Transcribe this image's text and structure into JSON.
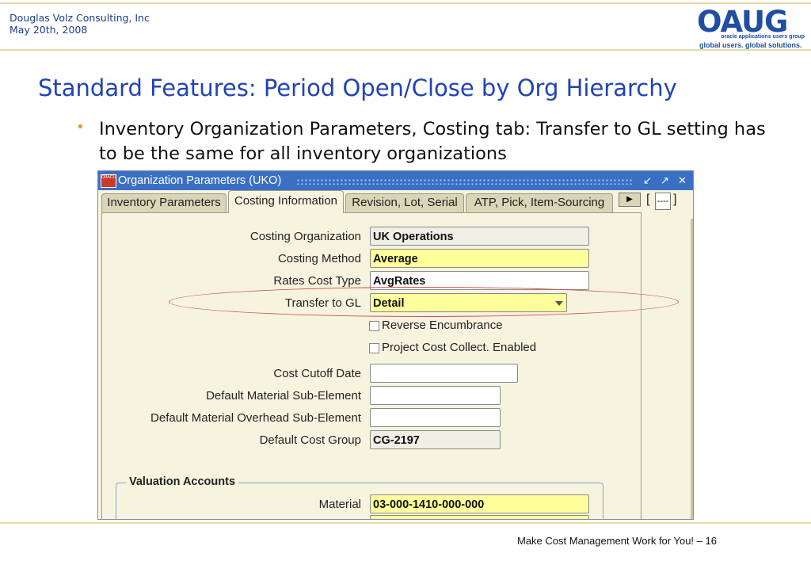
{
  "header": {
    "company": "Douglas Volz Consulting, Inc",
    "date": "May 20th, 2008",
    "logo": {
      "text": "OAUG",
      "subtitle": "oracle applications users group",
      "tagline": "global users. global solutions."
    }
  },
  "slide": {
    "title": "Standard Features:  Period Open/Close by Org Hierarchy",
    "bullet": "Inventory Organization Parameters, Costing tab:  Transfer to GL setting has to be the same for all inventory organizations",
    "footer": "Make Cost Management Work for You! – 16"
  },
  "window": {
    "title": "Organization Parameters (UKO)",
    "tabs": [
      "Inventory Parameters",
      "Costing Information",
      "Revision, Lot, Serial",
      "ATP, Pick, Item-Sourcing"
    ],
    "active_tab": "Costing Information",
    "tab_more_box": "----",
    "fields": {
      "costing_org": {
        "label": "Costing Organization",
        "value": "UK Operations"
      },
      "costing_method": {
        "label": "Costing Method",
        "value": "Average"
      },
      "rates_cost_type": {
        "label": "Rates Cost Type",
        "value": "AvgRates"
      },
      "transfer_to_gl": {
        "label": "Transfer to GL",
        "value": "Detail"
      },
      "reverse_encumbrance": {
        "label": "Reverse Encumbrance",
        "checked": false
      },
      "project_cost_collect": {
        "label": "Project Cost Collect. Enabled",
        "checked": false
      },
      "cost_cutoff_date": {
        "label": "Cost Cutoff Date",
        "value": ""
      },
      "default_material_sub_element": {
        "label": "Default Material Sub-Element",
        "value": ""
      },
      "default_material_overhead_sub_element": {
        "label": "Default Material Overhead Sub-Element",
        "value": ""
      },
      "default_cost_group": {
        "label": "Default Cost Group",
        "value": "CG-2197"
      }
    },
    "valuation": {
      "title": "Valuation Accounts",
      "material": {
        "label": "Material",
        "value": "03-000-1410-000-000"
      }
    }
  },
  "colors": {
    "title_blue": "#2043b5",
    "required_yellow": "#ffff9c",
    "highlight_red": "#d14b4b",
    "titlebar_blue": "#3a6fc4"
  }
}
